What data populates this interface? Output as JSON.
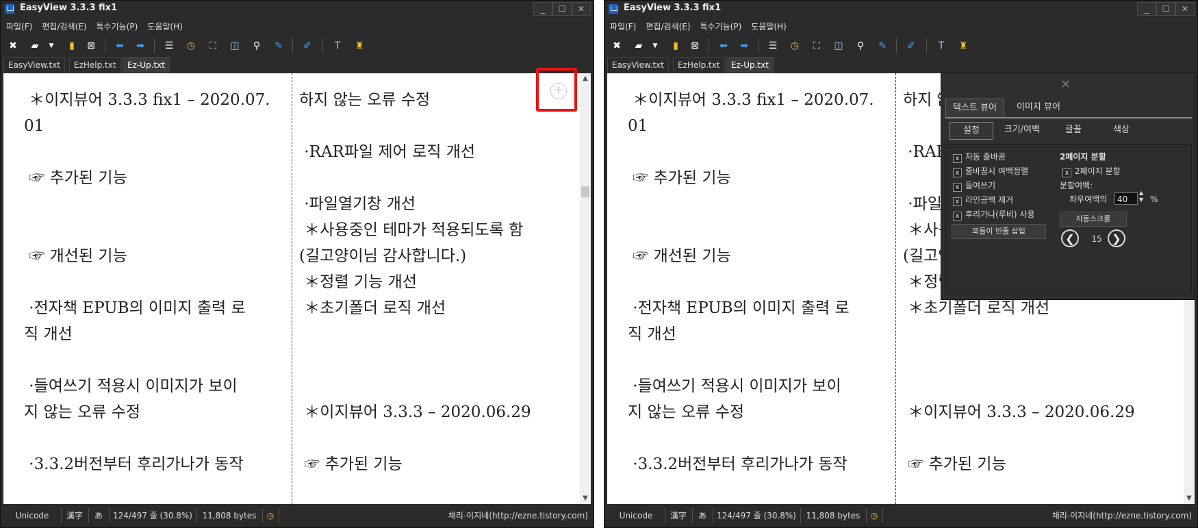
{
  "app": {
    "title": "EasyView  3.3.3 fix1"
  },
  "window_buttons": [
    "_",
    "☐",
    "✕"
  ],
  "menu": [
    "파일(F)",
    "편집/검색(E)",
    "특수기능(P)",
    "도움말(H)"
  ],
  "tabs": [
    "EasyView.txt",
    "EzHelp.txt",
    "Ez-Up.txt"
  ],
  "active_tab": "Ez-Up.txt",
  "toolbar_icons": [
    "close-file-icon",
    "open-folder-icon",
    "dropdown-arrow-icon",
    "bookmark-icon",
    "close-icon",
    "back-arrow-icon",
    "forward-arrow-icon",
    "toc-icon",
    "clock-icon",
    "fullscreen-icon",
    "layout-icon",
    "search-icon",
    "pin-icon",
    "pen-icon",
    "text-icon",
    "brush-icon"
  ],
  "text": {
    "left_col": [
      " ＊이지뷰어 3.3.3 fix1 – 2020.07.",
      "01",
      "",
      " ☞ 추가된 기능",
      "",
      "",
      " ☞ 개선된 기능",
      "",
      " ·전자책 EPUB의 이미지 출력 로",
      "직 개선",
      "",
      " ·들여쓰기 적용시 이미지가 보이",
      "지 않는 오류 수정",
      "",
      " ·3.3.2버전부터 후리가나가 동작"
    ],
    "right_col": [
      "하지 않는 오류 수정",
      "",
      " ·RAR파일 제어 로직 개선",
      "",
      " ·파일열기창 개선",
      " ＊사용중인 테마가 적용되도록 함",
      "(길고양이님 감사합니다.)",
      " ＊정렬 기능 개선",
      " ＊초기폴더 로직 개선",
      "",
      "",
      "",
      " ＊이지뷰어 3.3.3 – 2020.06.29",
      "",
      " ☞ 추가된 기능"
    ]
  },
  "status": {
    "encoding": "Unicode",
    "kanji": "漢字",
    "kana": "あ",
    "lines": "124/497 줄 (30.8%)",
    "bytes": "11,808 bytes",
    "credit": "채리-이지네(http://ezne.tistory.com)"
  },
  "panel": {
    "close": "✕",
    "main_tabs": [
      "텍스트 뷰어",
      "이미지 뷰어"
    ],
    "sub_tabs": [
      "설정",
      "크기/여백",
      "글꼴",
      "색상"
    ],
    "checkboxes": [
      {
        "label": "자동 줄바꿈",
        "checked": true
      },
      {
        "label": "줄바꿈시 여백정렬",
        "checked": true
      },
      {
        "label": "들여쓰기",
        "checked": true
      },
      {
        "label": "라인공백 제거",
        "checked": true
      },
      {
        "label": "후리가나(루비) 사용",
        "checked": true
      }
    ],
    "button_insert": "꾀돌이 빈줄 삽입",
    "two_page": {
      "heading": "2페이지 분할",
      "checkbox": {
        "label": "2페이지 분할",
        "checked": true
      },
      "margin_label": "분할여백:",
      "margin_lr_label": "좌우여백의",
      "margin_value": "40",
      "margin_unit": "%"
    },
    "autoscroll": {
      "label": "자동스크롤",
      "value": "15",
      "prev": "❮",
      "next": "❯"
    }
  },
  "colors": {
    "window_bg": "#2b2b2b",
    "highlight": "#ee1111",
    "text": "#222222"
  }
}
